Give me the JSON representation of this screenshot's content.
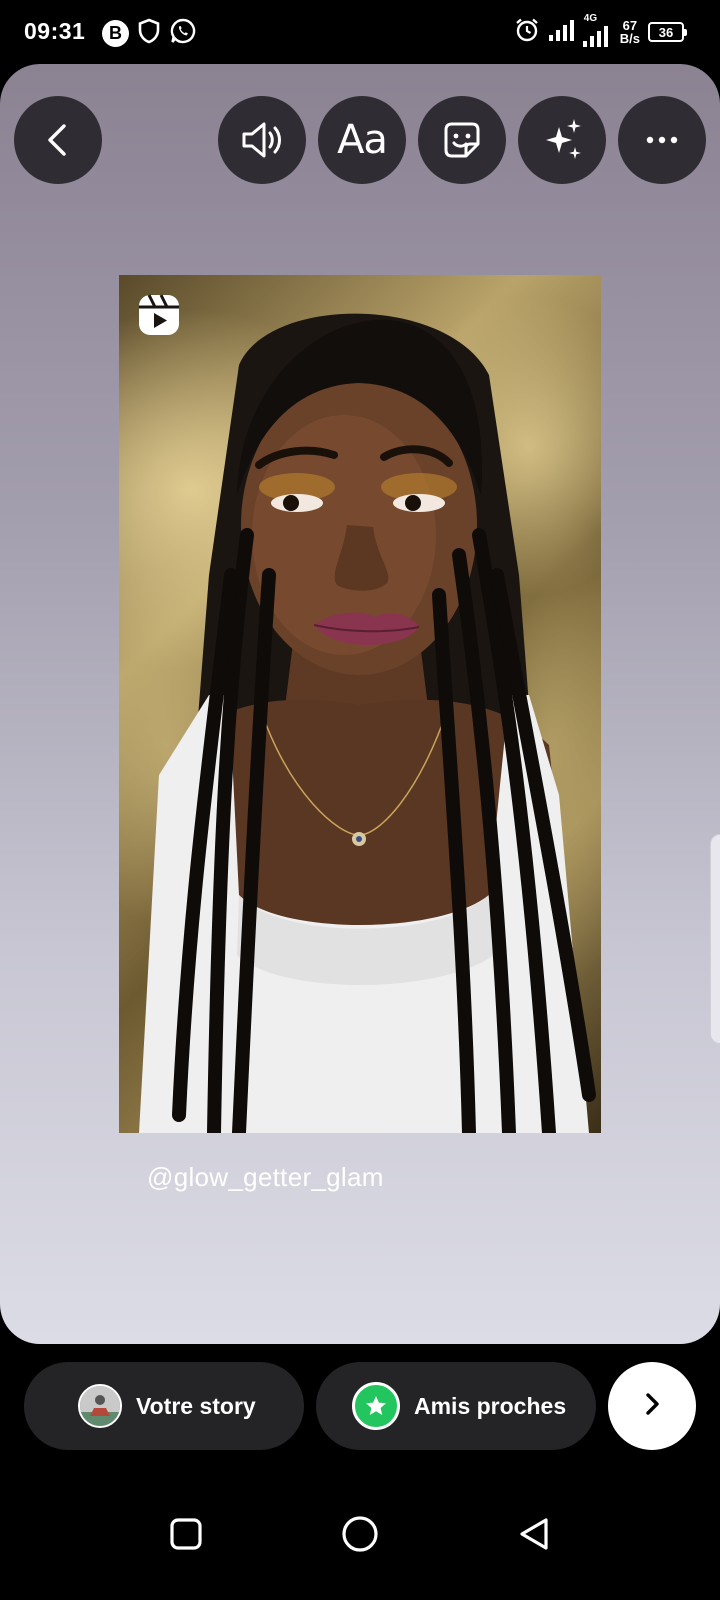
{
  "status_bar": {
    "time": "09:31",
    "left_badge": "B",
    "left_icons": [
      "b-badge-icon",
      "shield-icon",
      "whatsapp-icon"
    ],
    "right_icons": [
      "alarm-icon",
      "signal-icon",
      "signal-4g-icon"
    ],
    "network_type": "4G",
    "net_speed_value": "67",
    "net_speed_unit": "B/s",
    "battery": "36"
  },
  "toolbar": {
    "buttons": [
      "back-icon",
      "sound-icon",
      "text-icon",
      "sticker-icon",
      "effects-icon",
      "more-icon"
    ],
    "text_tool_label": "Aa"
  },
  "reel": {
    "icon": "reels-icon"
  },
  "mention": "@glow_getter_glam",
  "share": {
    "your_story_label": "Votre story",
    "close_friends_label": "Amis proches",
    "next_icon": "chevron-right-icon"
  },
  "colors": {
    "close_friends_green": "#22c55e",
    "pill_background": "#242326",
    "toolbar_button_background": "#2f2c33"
  },
  "nav": [
    "recents-icon",
    "home-icon",
    "back-triangle-icon"
  ]
}
